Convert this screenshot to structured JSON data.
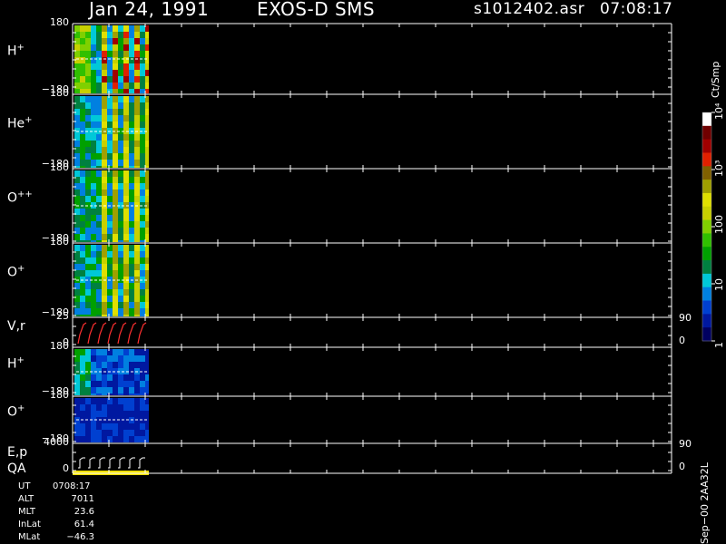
{
  "header": {
    "date": "Jan 24, 1991",
    "instrument": "EXOS-D SMS",
    "file": "s1012402.asr",
    "time": "07:08:17"
  },
  "panels": [
    {
      "id": "hplus",
      "label": "H",
      "sup": "+",
      "top_tick": "180",
      "bottom_tick": "−180"
    },
    {
      "id": "heplus",
      "label": "He",
      "sup": "+",
      "top_tick": "180",
      "bottom_tick": "−180"
    },
    {
      "id": "oplusplus",
      "label": "O",
      "sup": "++",
      "top_tick": "180",
      "bottom_tick": "−180"
    },
    {
      "id": "oplus",
      "label": "O",
      "sup": "+",
      "top_tick": "180",
      "bottom_tick": "−180"
    },
    {
      "id": "vr",
      "label": "V,r",
      "sup": "",
      "top_tick": "25",
      "bottom_tick": "0",
      "right_top": "90",
      "right_bottom": "0"
    },
    {
      "id": "hplus2",
      "label": "H",
      "sup": "+",
      "top_tick": "180",
      "bottom_tick": "−180"
    },
    {
      "id": "oplus2",
      "label": "O",
      "sup": "+",
      "top_tick": "180",
      "bottom_tick": "−180"
    },
    {
      "id": "ep",
      "label": "E,p",
      "sup": "",
      "label2": "QA",
      "top_tick": "4000",
      "bottom_tick": "0",
      "right_top": "90",
      "right_bottom": "0"
    }
  ],
  "colorbar": {
    "title": "Ct/Smp",
    "ticks": [
      {
        "text": "1",
        "level": 0.0
      },
      {
        "text": "10",
        "level": 0.25
      },
      {
        "text": "100",
        "level": 0.5
      },
      {
        "text": "10³",
        "level": 0.75
      },
      {
        "text": "10⁴",
        "level": 1.0
      }
    ],
    "colors": [
      "#000060",
      "#0018a0",
      "#0040d0",
      "#0080e0",
      "#00c8d8",
      "#008040",
      "#00a000",
      "#30c000",
      "#80d000",
      "#c8d000",
      "#e0e000",
      "#a0a000",
      "#806000",
      "#e02000",
      "#a00000",
      "#700000",
      "#ffffff"
    ]
  },
  "footer": {
    "rows": [
      {
        "key": "UT",
        "val": "0708:17"
      },
      {
        "key": "ALT",
        "val": "7011"
      },
      {
        "key": "MLT",
        "val": "23.6"
      },
      {
        "key": "InLat",
        "val": "61.4"
      },
      {
        "key": "MLat",
        "val": "−46.3"
      }
    ],
    "side_label": "Sep−00 2AA32L"
  },
  "chart_data": {
    "type": "heatmap",
    "title": "Jan 24, 1991  EXOS-D SMS",
    "series": [
      {
        "name": "H+",
        "ylim": [
          -180,
          180
        ],
        "unit": "Ct/Smp"
      },
      {
        "name": "He+",
        "ylim": [
          -180,
          180
        ],
        "unit": "Ct/Smp"
      },
      {
        "name": "O++",
        "ylim": [
          -180,
          180
        ],
        "unit": "Ct/Smp"
      },
      {
        "name": "O+",
        "ylim": [
          -180,
          180
        ],
        "unit": "Ct/Smp"
      },
      {
        "name": "V,r",
        "ylim": [
          0,
          25
        ],
        "right_ylim": [
          0,
          90
        ]
      },
      {
        "name": "H+",
        "ylim": [
          -180,
          180
        ],
        "unit": "Ct/Smp"
      },
      {
        "name": "O+",
        "ylim": [
          -180,
          180
        ],
        "unit": "Ct/Smp"
      },
      {
        "name": "E,p",
        "ylim": [
          0,
          4000
        ],
        "right_ylim": [
          0,
          90
        ]
      }
    ],
    "colorscale": "log",
    "color_range": [
      1,
      10000
    ],
    "data_coverage_fraction": 0.13,
    "grid": false,
    "legend": "right colorbar"
  }
}
